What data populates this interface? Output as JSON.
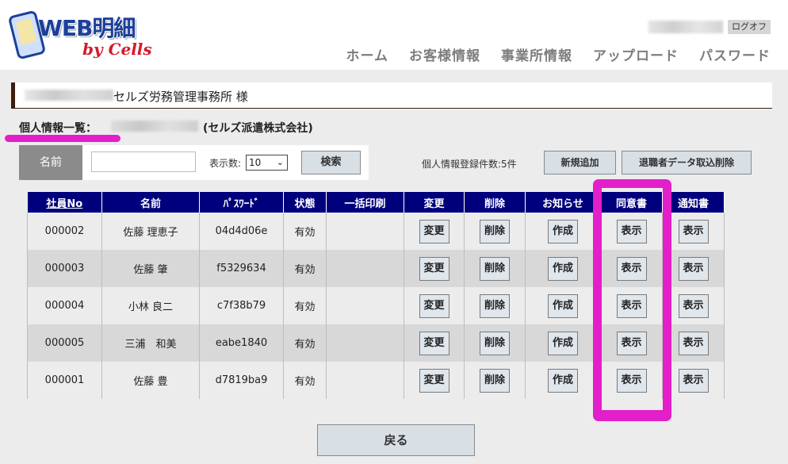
{
  "logo": {
    "title": "WEB明細",
    "subtitle": "by Cells"
  },
  "header": {
    "logoff_label": "ログオフ",
    "nav": [
      "ホーム",
      "お客様情報",
      "事業所情報",
      "アップロード",
      "パスワード"
    ]
  },
  "office": {
    "name": "セルズ労務管理事務所 様"
  },
  "section": {
    "title": "個人情報一覧：",
    "company": "(セルズ派遣株式会社)"
  },
  "search": {
    "name_label": "名前",
    "name_value": "",
    "count_label": "表示数:",
    "count_value": "10",
    "button_label": "検索"
  },
  "registration": {
    "count_text": "個人情報登録件数:5件"
  },
  "actions": {
    "new_label": "新規追加",
    "retire_delete_label": "退職者データ取込削除"
  },
  "table": {
    "headers": [
      "社員No",
      "名前",
      "ﾊﾟｽﾜｰﾄﾞ",
      "状態",
      "一括印刷",
      "変更",
      "削除",
      "お知らせ",
      "同意書",
      "通知書"
    ],
    "rows": [
      {
        "no": "000002",
        "name": "佐藤 理恵子",
        "password": "04d4d06e",
        "status": "有効",
        "bulk": "",
        "edit": "変更",
        "delete": "削除",
        "notice": "作成",
        "consent": "表示",
        "notification": "表示"
      },
      {
        "no": "000003",
        "name": "佐藤 肇",
        "password": "f5329634",
        "status": "有効",
        "bulk": "",
        "edit": "変更",
        "delete": "削除",
        "notice": "作成",
        "consent": "表示",
        "notification": "表示"
      },
      {
        "no": "000004",
        "name": "小林 良二",
        "password": "c7f38b79",
        "status": "有効",
        "bulk": "",
        "edit": "変更",
        "delete": "削除",
        "notice": "作成",
        "consent": "表示",
        "notification": "表示"
      },
      {
        "no": "000005",
        "name": "三浦　和美",
        "password": "eabe1840",
        "status": "有効",
        "bulk": "",
        "edit": "変更",
        "delete": "削除",
        "notice": "作成",
        "consent": "表示",
        "notification": "表示"
      },
      {
        "no": "000001",
        "name": "佐藤 豊",
        "password": "d7819ba9",
        "status": "有効",
        "bulk": "",
        "edit": "変更",
        "delete": "削除",
        "notice": "作成",
        "consent": "表示",
        "notification": "表示"
      }
    ]
  },
  "footer": {
    "back_label": "戻る"
  },
  "colors": {
    "table_header": "#00007d",
    "highlight": "#e21fc8",
    "logo_blue": "#1d3f9a",
    "logo_red": "#d51a2a"
  }
}
